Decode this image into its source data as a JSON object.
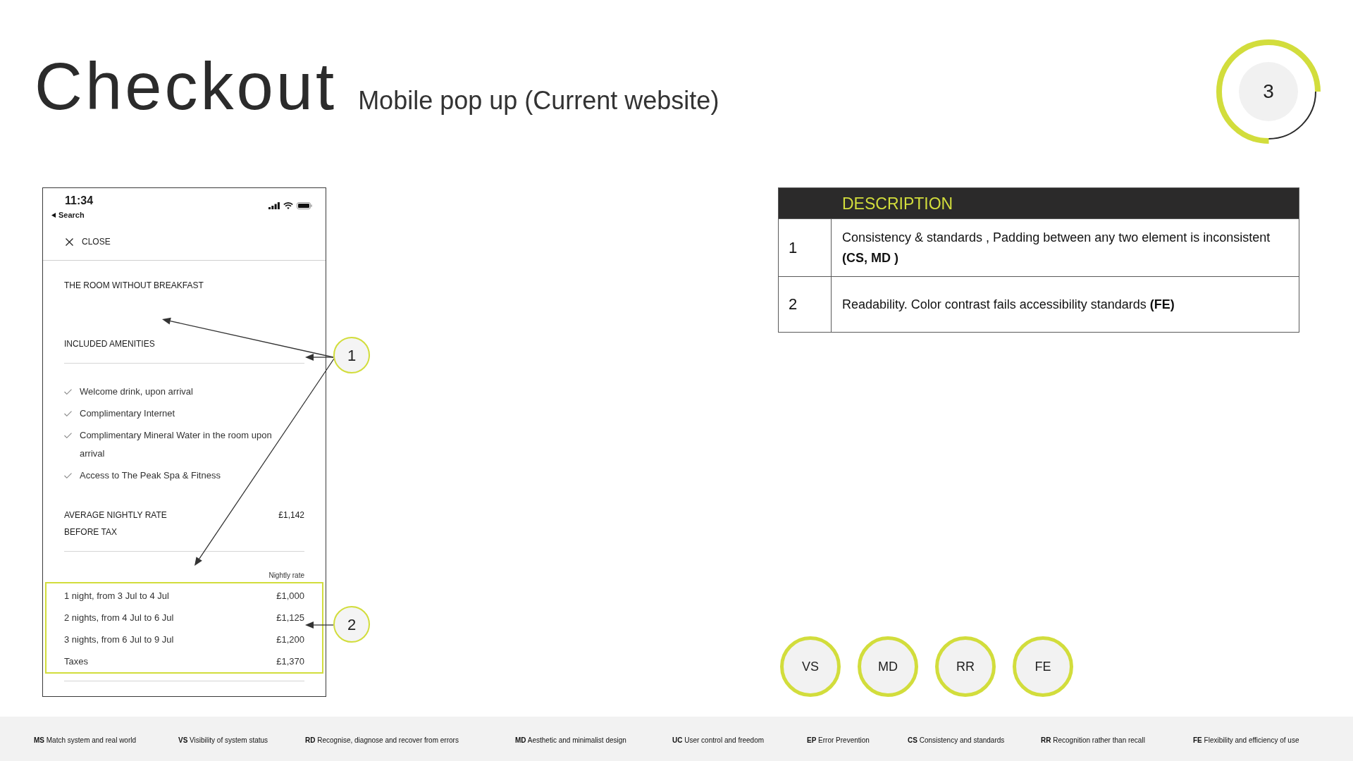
{
  "header": {
    "title": "Checkout",
    "subtitle": "Mobile pop up (Current website)"
  },
  "page_indicator": {
    "number": "3",
    "level": 0.75
  },
  "phone": {
    "status_bar": {
      "time": "11:34",
      "back_label": "Search"
    },
    "close_label": "CLOSE",
    "room_title": "THE ROOM WITHOUT BREAKFAST",
    "amenities_heading": "INCLUDED AMENITIES",
    "amenities": [
      "Welcome drink, upon arrival",
      "Complimentary Internet",
      "Complimentary Mineral Water in the room upon arrival",
      "Access to The Peak Spa & Fitness"
    ],
    "average_rate": {
      "label": "AVERAGE NIGHTLY RATE BEFORE TAX",
      "value": "£1,142"
    },
    "rates_caption": "Nightly rate",
    "rates": [
      {
        "label": "1 night, from 3 Jul to 4 Jul",
        "amount": "£1,000"
      },
      {
        "label": "2 nights, from 4 Jul to 6 Jul",
        "amount": "£1,125"
      },
      {
        "label": "3 nights, from 6 Jul to 9 Jul",
        "amount": "£1,200"
      },
      {
        "label": "Taxes",
        "amount": "£1,370"
      }
    ]
  },
  "callouts": [
    {
      "number": "1"
    },
    {
      "number": "2"
    }
  ],
  "issues_table": {
    "header": "DESCRIPTION",
    "rows": [
      {
        "number": "1",
        "description": "Consistency & standards , Padding between any two element is inconsistent **(CS, MD )**"
      },
      {
        "number": "2",
        "description": "Readability. Color contrast fails accessibility standards **(FE)**"
      }
    ]
  },
  "heuristic_badges": [
    "VS",
    "MD",
    "RR",
    "FE"
  ],
  "legend": [
    "**MS** Match system and real world",
    "**VS** Visibility of system status",
    "**RD** Recognise, diagnose and recover from errors",
    "**MD** Aesthetic and minimalist design",
    "**UC** User control and freedom",
    "**EP** Error Prevention",
    "**CS** Consistency and standards",
    "**RR** Recognition rather than recall",
    "**FE** Flexibility and efficiency of use"
  ]
}
